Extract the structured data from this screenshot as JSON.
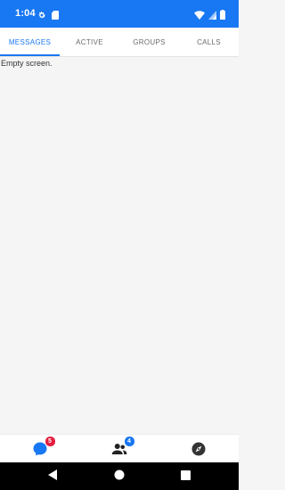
{
  "status_bar": {
    "time": "1:04",
    "left_icons": [
      "gear-icon",
      "sim-card-icon"
    ],
    "right_icons": [
      "wifi-icon",
      "cell-signal-icon",
      "battery-icon"
    ],
    "background_color": "#1877f2"
  },
  "tabs": [
    {
      "label": "MESSAGES",
      "active": true
    },
    {
      "label": "ACTIVE",
      "active": false
    },
    {
      "label": "GROUPS",
      "active": false
    },
    {
      "label": "CALLS",
      "active": false
    }
  ],
  "content": {
    "empty_text": "Empty screen."
  },
  "bottom_nav": {
    "items": [
      {
        "icon": "chat-bubble-icon",
        "badge": "5",
        "badge_color": "#e41e3f"
      },
      {
        "icon": "people-icon",
        "badge": "4",
        "badge_color": "#1877f2"
      },
      {
        "icon": "compass-icon",
        "badge": null
      }
    ]
  },
  "system_nav": [
    "back-icon",
    "home-icon",
    "recents-icon"
  ],
  "colors": {
    "accent": "#1877f2",
    "badge_red": "#e41e3f"
  }
}
